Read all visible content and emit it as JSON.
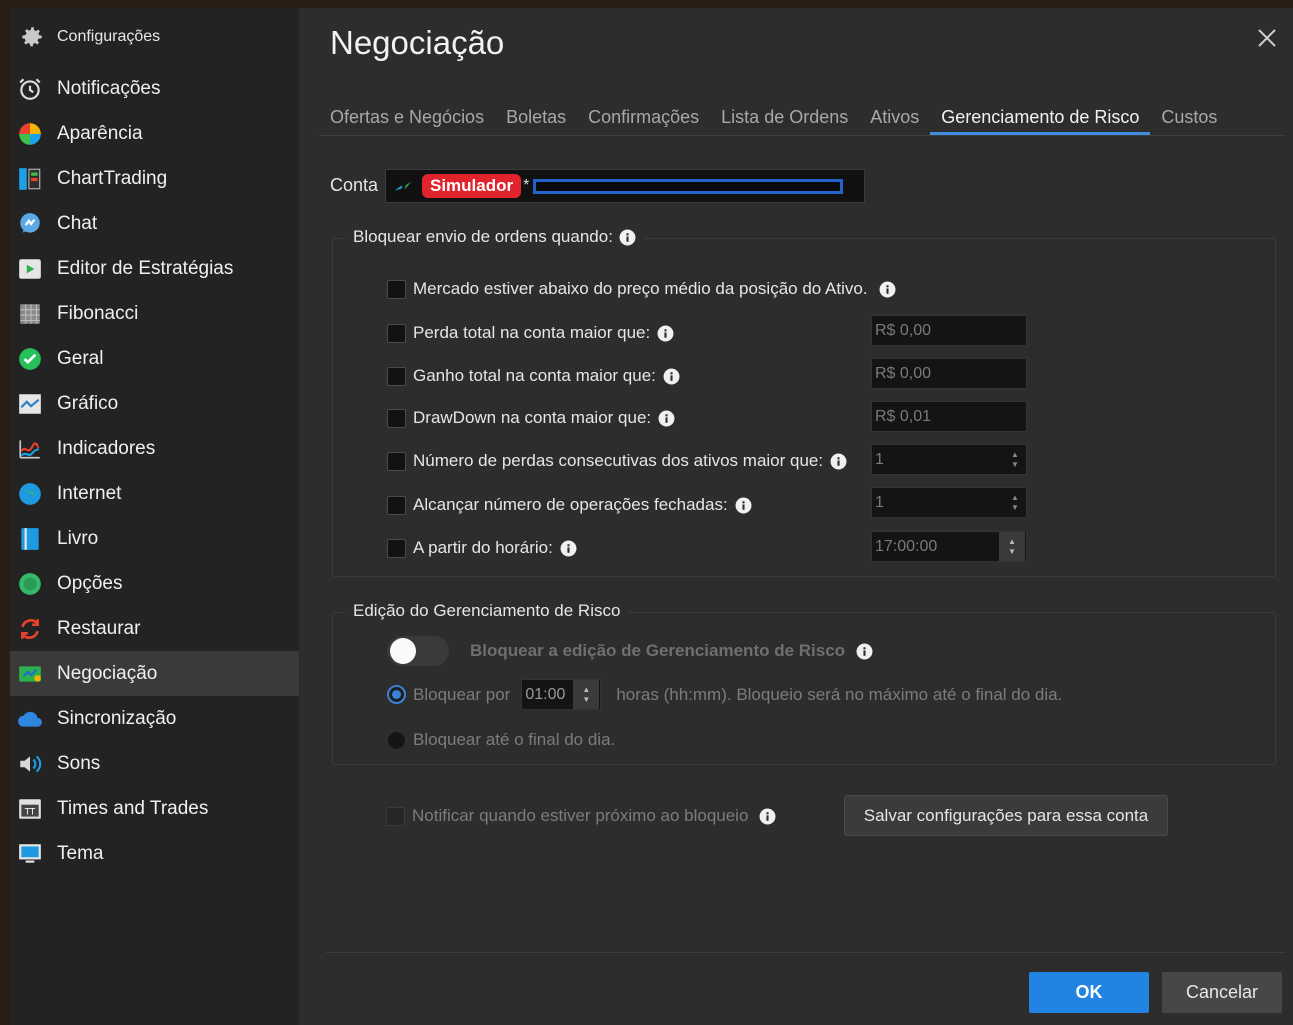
{
  "sidebar": {
    "header": "Configurações",
    "items": [
      {
        "label": "Notificações",
        "icon": "alarm-clock-icon"
      },
      {
        "label": "Aparência",
        "icon": "color-wheel-icon"
      },
      {
        "label": "ChartTrading",
        "icon": "chart-trading-icon"
      },
      {
        "label": "Chat",
        "icon": "chat-icon"
      },
      {
        "label": "Editor de Estratégias",
        "icon": "play-editor-icon"
      },
      {
        "label": "Fibonacci",
        "icon": "fibonacci-grid-icon"
      },
      {
        "label": "Geral",
        "icon": "check-circle-icon"
      },
      {
        "label": "Gráfico",
        "icon": "chart-line-icon"
      },
      {
        "label": "Indicadores",
        "icon": "indicator-lines-icon"
      },
      {
        "label": "Internet",
        "icon": "globe-icon"
      },
      {
        "label": "Livro",
        "icon": "book-icon"
      },
      {
        "label": "Opções",
        "icon": "options-circle-icon"
      },
      {
        "label": "Restaurar",
        "icon": "restore-arrows-icon"
      },
      {
        "label": "Negociação",
        "icon": "trading-icon"
      },
      {
        "label": "Sincronização",
        "icon": "cloud-icon"
      },
      {
        "label": "Sons",
        "icon": "speaker-icon"
      },
      {
        "label": "Times and Trades",
        "icon": "times-trades-icon"
      },
      {
        "label": "Tema",
        "icon": "monitor-icon"
      }
    ],
    "active_index": 13
  },
  "main": {
    "title": "Negociação",
    "tabs": [
      {
        "label": "Ofertas e Negócios"
      },
      {
        "label": "Boletas"
      },
      {
        "label": "Confirmações"
      },
      {
        "label": "Lista de Ordens"
      },
      {
        "label": "Ativos"
      },
      {
        "label": "Gerenciamento de Risco"
      },
      {
        "label": "Custos"
      }
    ],
    "active_tab": 5,
    "conta": {
      "label": "Conta",
      "badge": "Simulador",
      "asterisk": "*"
    },
    "block_group": {
      "title": "Bloquear envio de ordens quando:",
      "rows": [
        {
          "label": "Mercado estiver abaixo do preço médio da posição do Ativo."
        },
        {
          "label": "Perda total na conta maior que:",
          "value": "R$ 0,00"
        },
        {
          "label": "Ganho total na conta maior que:",
          "value": "R$ 0,00"
        },
        {
          "label": "DrawDown na conta maior que:",
          "value": "R$ 0,01"
        },
        {
          "label": "Número de perdas consecutivas dos ativos maior que:",
          "value": "1"
        },
        {
          "label": "Alcançar número de operações fechadas:",
          "value": "1"
        },
        {
          "label": "A partir do horário:",
          "value": "17:00:00"
        }
      ]
    },
    "edit_group": {
      "title": "Edição do Gerenciamento de Risco",
      "toggle_label": "Bloquear a edição de Gerenciamento de Risco",
      "radio1_label": "Bloquear por",
      "radio1_value": "01:00",
      "radio1_suffix": "horas (hh:mm). Bloqueio será no máximo até o final do dia.",
      "radio2_label": "Bloquear até o final do dia."
    },
    "notify_label": "Notificar quando estiver próximo ao bloqueio",
    "save_button": "Salvar configurações para essa conta",
    "ok_button": "OK",
    "cancel_button": "Cancelar"
  }
}
